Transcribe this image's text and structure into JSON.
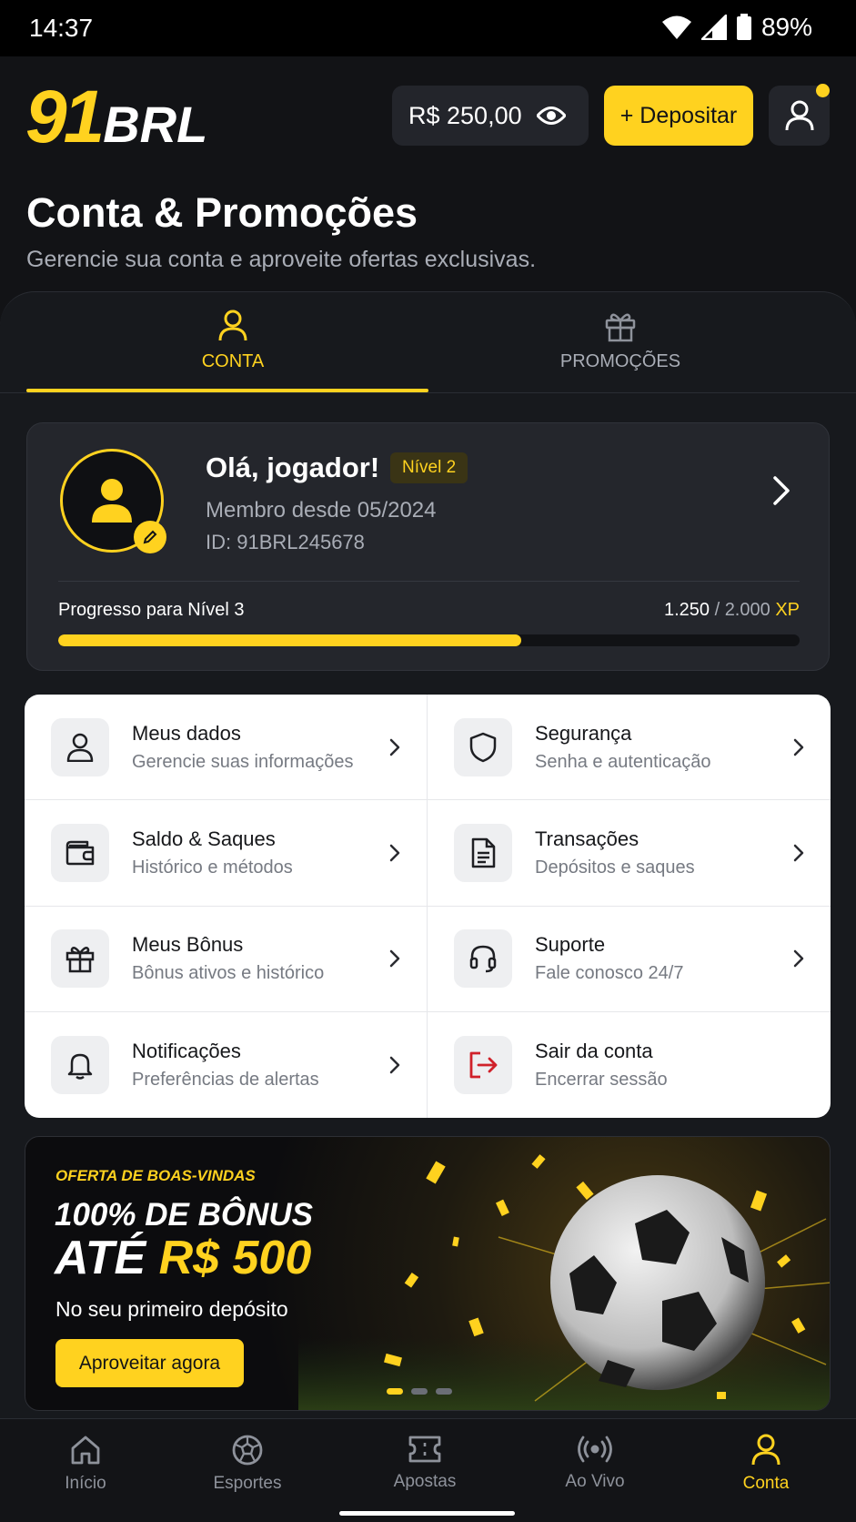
{
  "status_bar": {
    "time": "14:37",
    "battery": "89%"
  },
  "header": {
    "logo_number": "91",
    "logo_text": "BRL",
    "balance": "R$ 250,00",
    "deposit_label": "+ Depositar"
  },
  "page": {
    "title": "Conta & Promoções",
    "subtitle": "Gerencie sua conta e aproveite ofertas exclusivas."
  },
  "tabs": [
    {
      "label": "CONTA",
      "active": true
    },
    {
      "label": "PROMOÇÕES",
      "active": false
    }
  ],
  "profile": {
    "greeting": "Olá, jogador!",
    "level_badge": "Nível 2",
    "member_since": "Membro desde 05/2024",
    "user_id": "ID: 91BRL245678",
    "progress_label": "Progresso para Nível 3",
    "xp_current": "1.250",
    "xp_separator": " / ",
    "xp_total": "2.000",
    "xp_unit": "XP",
    "progress_fraction": 0.625
  },
  "menu": [
    {
      "title": "Meus dados",
      "subtitle": "Gerencie suas informações",
      "icon": "user-icon"
    },
    {
      "title": "Segurança",
      "subtitle": "Senha e autenticação",
      "icon": "shield-icon"
    },
    {
      "title": "Saldo & Saques",
      "subtitle": "Histórico e métodos",
      "icon": "wallet-icon"
    },
    {
      "title": "Transações",
      "subtitle": "Depósitos e saques",
      "icon": "document-icon"
    },
    {
      "title": "Meus Bônus",
      "subtitle": "Bônus ativos e histórico",
      "icon": "gift-icon"
    },
    {
      "title": "Suporte",
      "subtitle": "Fale conosco 24/7",
      "icon": "headset-icon"
    },
    {
      "title": "Notificações",
      "subtitle": "Preferências de alertas",
      "icon": "bell-icon"
    },
    {
      "title": "Sair da conta",
      "subtitle": "Encerrar sessão",
      "icon": "logout-icon"
    }
  ],
  "promo": {
    "eyebrow": "OFERTA DE BOAS-VINDAS",
    "line1": "100% DE BÔNUS",
    "line2_prefix": "ATÉ ",
    "line2_accent": "R$ 500",
    "description": "No seu primeiro depósito",
    "cta": "Aproveitar agora",
    "slides": 3,
    "active_slide": 0
  },
  "bottom_nav": [
    {
      "label": "Início",
      "icon": "home-icon",
      "active": false
    },
    {
      "label": "Esportes",
      "icon": "ball-icon",
      "active": false
    },
    {
      "label": "Apostas",
      "icon": "ticket-icon",
      "active": false
    },
    {
      "label": "Ao Vivo",
      "icon": "live-icon",
      "active": false
    },
    {
      "label": "Conta",
      "icon": "user-icon",
      "active": true
    }
  ],
  "colors": {
    "accent": "#FFD21F",
    "background": "#121316",
    "card": "#24262C",
    "danger": "#D0212A"
  }
}
